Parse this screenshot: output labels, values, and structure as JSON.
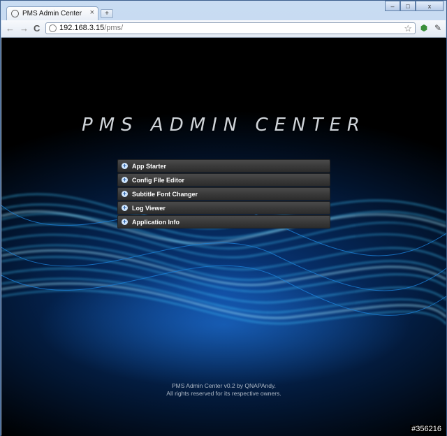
{
  "browser": {
    "tab_title": "PMS Admin Center",
    "tab_close": "×",
    "new_tab": "+",
    "window_controls": {
      "minimize": "–",
      "maximize": "□",
      "close": "x"
    },
    "url_host": "192.168.3.15",
    "url_path": "/pms/",
    "nav": {
      "back": "←",
      "forward": "→",
      "reload": "C"
    },
    "icons": [
      "back-icon",
      "forward-icon",
      "reload-icon",
      "globe-icon",
      "star-icon",
      "extension-icon",
      "wrench-icon"
    ]
  },
  "page": {
    "logo_text": "PMS ADMIN CENTER",
    "menu": [
      {
        "label": "App Starter"
      },
      {
        "label": "Config File Editor"
      },
      {
        "label": "Subtitle Font Changer"
      },
      {
        "label": "Log Viewer"
      },
      {
        "label": "Application Info"
      }
    ],
    "footer_line1": "PMS Admin Center v0.2 by QNAPAndy.",
    "footer_line2": "All rights reserved for its respective owners.",
    "corner_id": "#356216"
  },
  "colors": {
    "background": "#000000",
    "wave": "#3fc6ff",
    "menu_bg": "#3a3a3a"
  }
}
